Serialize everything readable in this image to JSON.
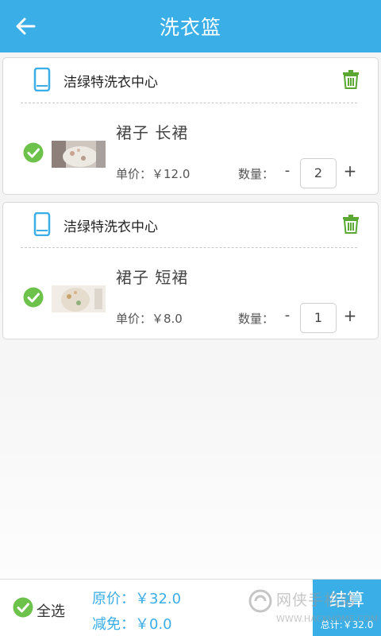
{
  "header": {
    "title": "洗衣篮"
  },
  "shops": [
    {
      "name": "洁绿特洗衣中心",
      "item": {
        "name": "裙子  长裙",
        "price": "单价：￥12.0",
        "qty_label": "数量：",
        "minus": "-",
        "qty": "2",
        "plus": "+"
      }
    },
    {
      "name": "洁绿特洗衣中心",
      "item": {
        "name": "裙子  短裙",
        "price": "单价：￥8.0",
        "qty_label": "数量：",
        "minus": "-",
        "qty": "1",
        "plus": "+"
      }
    }
  ],
  "footer": {
    "select_all": "全选",
    "original": "原价：￥32.0",
    "discount": "减免：￥0.0",
    "checkout": "结算",
    "total": "总计:￥32.0"
  },
  "watermark": {
    "text": "网侠手机站",
    "url": "WWW.HACKHOME.COM"
  },
  "colors": {
    "accent": "#3aaee6",
    "check": "#6cc24a",
    "trash": "#5aa832"
  },
  "icons": [
    "back-arrow-icon",
    "phone-icon",
    "trash-icon",
    "check-circle-icon"
  ]
}
